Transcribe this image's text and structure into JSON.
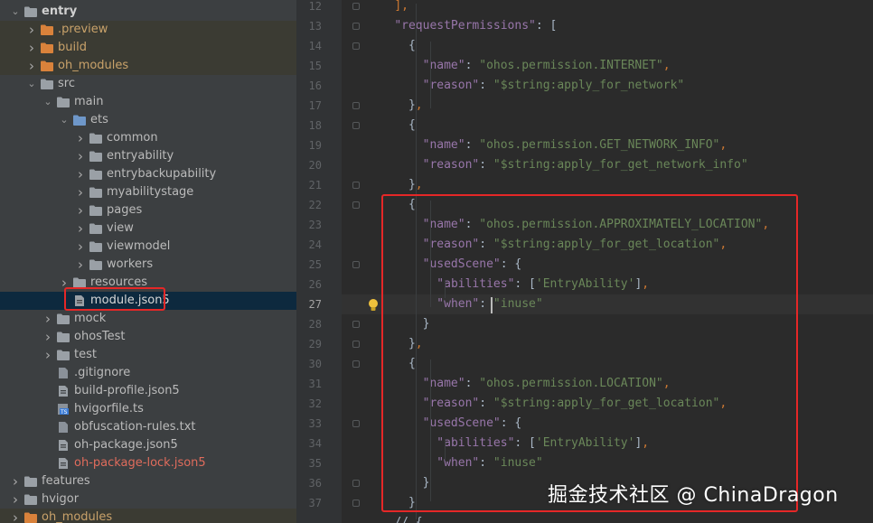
{
  "project_tree": {
    "rows": [
      {
        "label": "entry",
        "type": "folder",
        "indent": 0,
        "expanded": true,
        "style": "bold"
      },
      {
        "label": ".preview",
        "type": "folder-orange",
        "indent": 1,
        "expanded": false,
        "style": "excluded"
      },
      {
        "label": "build",
        "type": "folder-orange",
        "indent": 1,
        "expanded": false,
        "style": "excluded"
      },
      {
        "label": "oh_modules",
        "type": "folder-orange",
        "indent": 1,
        "expanded": false,
        "style": "excluded"
      },
      {
        "label": "src",
        "type": "folder",
        "indent": 1,
        "expanded": true,
        "style": "normal"
      },
      {
        "label": "main",
        "type": "folder",
        "indent": 2,
        "expanded": true,
        "style": "normal"
      },
      {
        "label": "ets",
        "type": "folder-blue",
        "indent": 3,
        "expanded": true,
        "style": "normal"
      },
      {
        "label": "common",
        "type": "folder",
        "indent": 4,
        "expanded": false,
        "style": "normal"
      },
      {
        "label": "entryability",
        "type": "folder",
        "indent": 4,
        "expanded": false,
        "style": "normal"
      },
      {
        "label": "entrybackupability",
        "type": "folder",
        "indent": 4,
        "expanded": false,
        "style": "normal"
      },
      {
        "label": "myabilitystage",
        "type": "folder",
        "indent": 4,
        "expanded": false,
        "style": "normal"
      },
      {
        "label": "pages",
        "type": "folder",
        "indent": 4,
        "expanded": false,
        "style": "normal"
      },
      {
        "label": "view",
        "type": "folder",
        "indent": 4,
        "expanded": false,
        "style": "normal"
      },
      {
        "label": "viewmodel",
        "type": "folder",
        "indent": 4,
        "expanded": false,
        "style": "normal"
      },
      {
        "label": "workers",
        "type": "folder",
        "indent": 4,
        "expanded": false,
        "style": "normal"
      },
      {
        "label": "resources",
        "type": "folder",
        "indent": 3,
        "expanded": false,
        "style": "normal"
      },
      {
        "label": "module.json5",
        "type": "file-json",
        "indent": 3,
        "expanded": null,
        "style": "selected"
      },
      {
        "label": "mock",
        "type": "folder",
        "indent": 2,
        "expanded": false,
        "style": "normal"
      },
      {
        "label": "ohosTest",
        "type": "folder",
        "indent": 2,
        "expanded": false,
        "style": "normal"
      },
      {
        "label": "test",
        "type": "folder",
        "indent": 2,
        "expanded": false,
        "style": "normal"
      },
      {
        "label": ".gitignore",
        "type": "file",
        "indent": 2,
        "expanded": null,
        "style": "normal"
      },
      {
        "label": "build-profile.json5",
        "type": "file-json",
        "indent": 2,
        "expanded": null,
        "style": "normal"
      },
      {
        "label": "hvigorfile.ts",
        "type": "file-ts",
        "indent": 2,
        "expanded": null,
        "style": "normal"
      },
      {
        "label": "obfuscation-rules.txt",
        "type": "file",
        "indent": 2,
        "expanded": null,
        "style": "normal"
      },
      {
        "label": "oh-package.json5",
        "type": "file-json",
        "indent": 2,
        "expanded": null,
        "style": "normal"
      },
      {
        "label": "oh-package-lock.json5",
        "type": "file-json",
        "indent": 2,
        "expanded": null,
        "style": "warn"
      },
      {
        "label": "features",
        "type": "folder",
        "indent": 0,
        "expanded": false,
        "style": "normal"
      },
      {
        "label": "hvigor",
        "type": "folder",
        "indent": 0,
        "expanded": false,
        "style": "normal"
      },
      {
        "label": "oh_modules",
        "type": "folder-orange",
        "indent": 0,
        "expanded": false,
        "style": "excluded"
      }
    ]
  },
  "editor": {
    "current_line": "27",
    "lines": [
      {
        "n": "12",
        "indent": 2,
        "tokens": [
          [
            "p",
            "],"
          ]
        ]
      },
      {
        "n": "13",
        "indent": 2,
        "tokens": [
          [
            "k",
            "\"requestPermissions\""
          ],
          [
            "t",
            ": ["
          ]
        ]
      },
      {
        "n": "14",
        "indent": 3,
        "tokens": [
          [
            "t",
            "{"
          ]
        ]
      },
      {
        "n": "15",
        "indent": 4,
        "tokens": [
          [
            "k",
            "\"name\""
          ],
          [
            "t",
            ": "
          ],
          [
            "s",
            "\"ohos.permission.INTERNET\""
          ],
          [
            "p",
            ","
          ]
        ]
      },
      {
        "n": "16",
        "indent": 4,
        "tokens": [
          [
            "k",
            "\"reason\""
          ],
          [
            "t",
            ": "
          ],
          [
            "s",
            "\"$string:apply_for_network\""
          ]
        ]
      },
      {
        "n": "17",
        "indent": 3,
        "tokens": [
          [
            "t",
            "}"
          ],
          [
            "p",
            ","
          ]
        ]
      },
      {
        "n": "18",
        "indent": 3,
        "tokens": [
          [
            "t",
            "{"
          ]
        ]
      },
      {
        "n": "19",
        "indent": 4,
        "tokens": [
          [
            "k",
            "\"name\""
          ],
          [
            "t",
            ": "
          ],
          [
            "s",
            "\"ohos.permission.GET_NETWORK_INFO\""
          ],
          [
            "p",
            ","
          ]
        ]
      },
      {
        "n": "20",
        "indent": 4,
        "tokens": [
          [
            "k",
            "\"reason\""
          ],
          [
            "t",
            ": "
          ],
          [
            "s",
            "\"$string:apply_for_get_network_info\""
          ]
        ]
      },
      {
        "n": "21",
        "indent": 3,
        "tokens": [
          [
            "t",
            "}"
          ],
          [
            "p",
            ","
          ]
        ]
      },
      {
        "n": "22",
        "indent": 3,
        "tokens": [
          [
            "t",
            "{"
          ]
        ]
      },
      {
        "n": "23",
        "indent": 4,
        "tokens": [
          [
            "k",
            "\"name\""
          ],
          [
            "t",
            ": "
          ],
          [
            "s",
            "\"ohos.permission.APPROXIMATELY_LOCATION\""
          ],
          [
            "p",
            ","
          ]
        ]
      },
      {
        "n": "24",
        "indent": 4,
        "tokens": [
          [
            "k",
            "\"reason\""
          ],
          [
            "t",
            ": "
          ],
          [
            "s",
            "\"$string:apply_for_get_location\""
          ],
          [
            "p",
            ","
          ]
        ]
      },
      {
        "n": "25",
        "indent": 4,
        "tokens": [
          [
            "k",
            "\"usedScene\""
          ],
          [
            "t",
            ": {"
          ]
        ]
      },
      {
        "n": "26",
        "indent": 5,
        "tokens": [
          [
            "k",
            "\"abilities\""
          ],
          [
            "t",
            ": ["
          ],
          [
            "s",
            "'EntryAbility'"
          ],
          [
            "t",
            "]"
          ],
          [
            "p",
            ","
          ]
        ]
      },
      {
        "n": "27",
        "indent": 5,
        "tokens": [
          [
            "k",
            "\"when\""
          ],
          [
            "t",
            ": "
          ],
          [
            "s",
            "\"inuse\""
          ]
        ]
      },
      {
        "n": "28",
        "indent": 4,
        "tokens": [
          [
            "t",
            "}"
          ]
        ]
      },
      {
        "n": "29",
        "indent": 3,
        "tokens": [
          [
            "t",
            "}"
          ],
          [
            "p",
            ","
          ]
        ]
      },
      {
        "n": "30",
        "indent": 3,
        "tokens": [
          [
            "t",
            "{"
          ]
        ]
      },
      {
        "n": "31",
        "indent": 4,
        "tokens": [
          [
            "k",
            "\"name\""
          ],
          [
            "t",
            ": "
          ],
          [
            "s",
            "\"ohos.permission.LOCATION\""
          ],
          [
            "p",
            ","
          ]
        ]
      },
      {
        "n": "32",
        "indent": 4,
        "tokens": [
          [
            "k",
            "\"reason\""
          ],
          [
            "t",
            ": "
          ],
          [
            "s",
            "\"$string:apply_for_get_location\""
          ],
          [
            "p",
            ","
          ]
        ]
      },
      {
        "n": "33",
        "indent": 4,
        "tokens": [
          [
            "k",
            "\"usedScene\""
          ],
          [
            "t",
            ": {"
          ]
        ]
      },
      {
        "n": "34",
        "indent": 5,
        "tokens": [
          [
            "k",
            "\"abilities\""
          ],
          [
            "t",
            ": ["
          ],
          [
            "s",
            "'EntryAbility'"
          ],
          [
            "t",
            "]"
          ],
          [
            "p",
            ","
          ]
        ]
      },
      {
        "n": "35",
        "indent": 5,
        "tokens": [
          [
            "k",
            "\"when\""
          ],
          [
            "t",
            ": "
          ],
          [
            "s",
            "\"inuse\""
          ]
        ]
      },
      {
        "n": "36",
        "indent": 4,
        "tokens": [
          [
            "t",
            "}"
          ]
        ]
      },
      {
        "n": "37",
        "indent": 3,
        "tokens": [
          [
            "t",
            "}"
          ]
        ]
      },
      {
        "n": "",
        "indent": 2,
        "tokens": [
          [
            "t",
            "// "
          ],
          [
            "t",
            "{"
          ]
        ]
      }
    ]
  },
  "watermark": "掘金技术社区 @ ChinaDragon",
  "colors": {
    "tree_bg": "#3c3f41",
    "editor_bg": "#2b2b2b",
    "gutter_bg": "#313335",
    "selection": "#0d293e",
    "highlight_red": "#e52727",
    "json_key": "#9876aa",
    "json_string": "#6a8759",
    "punctuation": "#cc7832"
  }
}
